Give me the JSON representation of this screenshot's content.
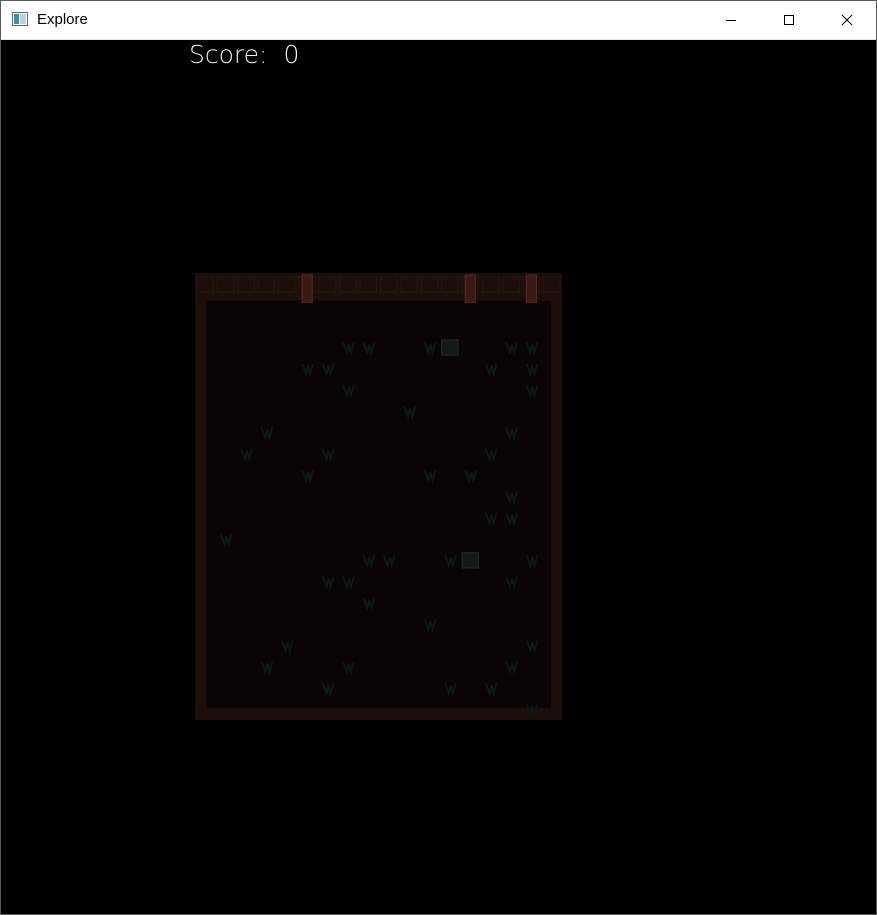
{
  "window": {
    "title": "Explore",
    "icon": "app-window-icon",
    "controls": {
      "minimize": "minimize-icon",
      "maximize": "maximize-icon",
      "close": "close-icon"
    }
  },
  "hud": {
    "score_label": "Score:",
    "score_value": "0"
  },
  "game": {
    "grid_columns": 18,
    "grid_rows": 21,
    "colors": {
      "background": "#000000",
      "board_floor": "#0a0504",
      "board_wall": "#1c0f0a",
      "door": "#3a1a14",
      "grass": "#0b1a12",
      "block": "#141a18"
    },
    "doors": [
      {
        "col": 5,
        "row": 0
      },
      {
        "col": 13,
        "row": 0
      },
      {
        "col": 16,
        "row": 0
      }
    ],
    "grass": [
      {
        "col": 7,
        "row": 3
      },
      {
        "col": 8,
        "row": 3
      },
      {
        "col": 11,
        "row": 3
      },
      {
        "col": 15,
        "row": 3
      },
      {
        "col": 16,
        "row": 3
      },
      {
        "col": 5,
        "row": 4
      },
      {
        "col": 6,
        "row": 4
      },
      {
        "col": 14,
        "row": 4
      },
      {
        "col": 16,
        "row": 4
      },
      {
        "col": 7,
        "row": 5
      },
      {
        "col": 16,
        "row": 5
      },
      {
        "col": 10,
        "row": 6
      },
      {
        "col": 3,
        "row": 7
      },
      {
        "col": 15,
        "row": 7
      },
      {
        "col": 2,
        "row": 8
      },
      {
        "col": 6,
        "row": 8
      },
      {
        "col": 14,
        "row": 8
      },
      {
        "col": 5,
        "row": 9
      },
      {
        "col": 11,
        "row": 9
      },
      {
        "col": 13,
        "row": 9
      },
      {
        "col": 15,
        "row": 10
      },
      {
        "col": 14,
        "row": 11
      },
      {
        "col": 15,
        "row": 11
      },
      {
        "col": 1,
        "row": 12
      },
      {
        "col": 8,
        "row": 13
      },
      {
        "col": 9,
        "row": 13
      },
      {
        "col": 12,
        "row": 13
      },
      {
        "col": 16,
        "row": 13
      },
      {
        "col": 6,
        "row": 14
      },
      {
        "col": 7,
        "row": 14
      },
      {
        "col": 15,
        "row": 14
      },
      {
        "col": 8,
        "row": 15
      },
      {
        "col": 11,
        "row": 16
      },
      {
        "col": 4,
        "row": 17
      },
      {
        "col": 16,
        "row": 17
      },
      {
        "col": 3,
        "row": 18
      },
      {
        "col": 7,
        "row": 18
      },
      {
        "col": 15,
        "row": 18
      },
      {
        "col": 6,
        "row": 19
      },
      {
        "col": 12,
        "row": 19
      },
      {
        "col": 14,
        "row": 19
      },
      {
        "col": 16,
        "row": 20
      }
    ],
    "blocks": [
      {
        "col": 12,
        "row": 3
      },
      {
        "col": 13,
        "row": 13
      }
    ]
  }
}
